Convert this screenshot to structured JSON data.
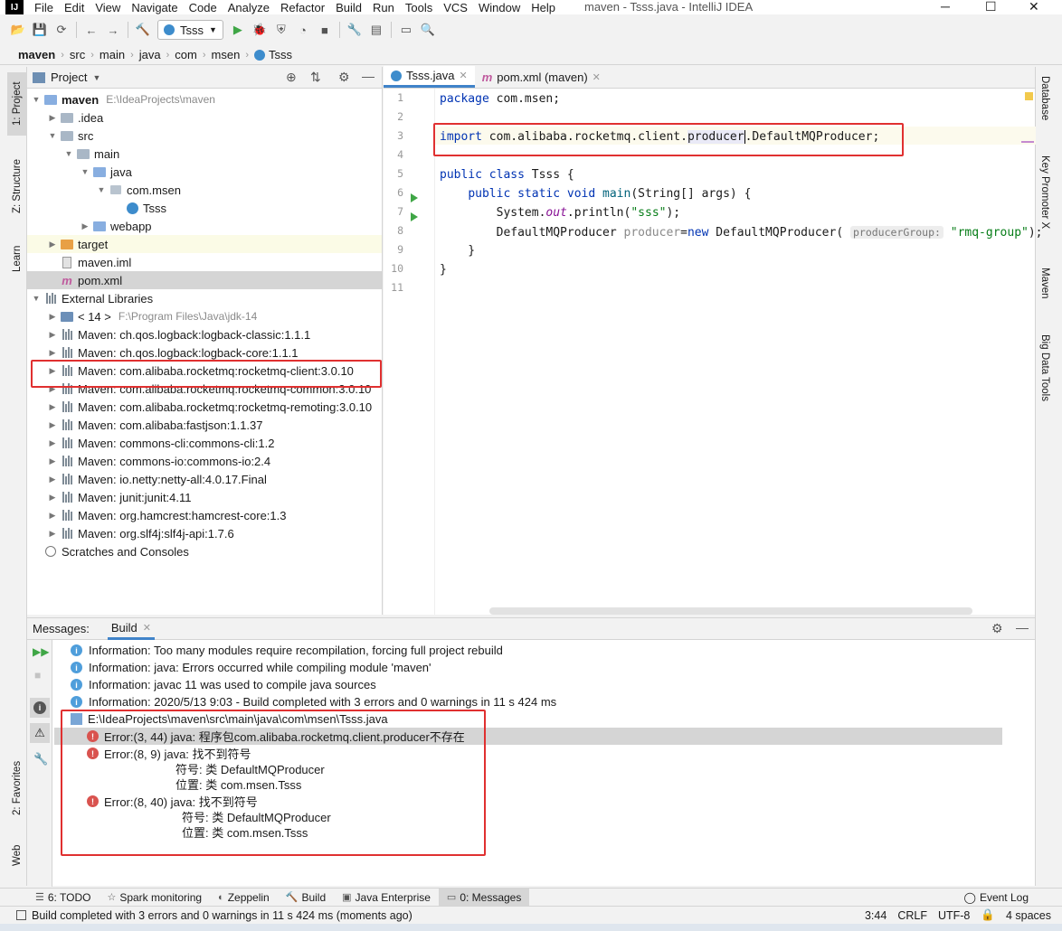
{
  "window": {
    "title": "maven - Tsss.java - IntelliJ IDEA",
    "logo": "IJ"
  },
  "menu": [
    "File",
    "Edit",
    "View",
    "Navigate",
    "Code",
    "Analyze",
    "Refactor",
    "Build",
    "Run",
    "Tools",
    "VCS",
    "Window",
    "Help"
  ],
  "toolbar": {
    "run_config": "Tsss"
  },
  "breadcrumb": [
    "maven",
    "src",
    "main",
    "java",
    "com",
    "msen",
    "Tsss"
  ],
  "left_tabs": {
    "project": "1: Project",
    "structure": "Z: Structure",
    "learn": "Learn",
    "favorites": "2: Favorites",
    "web": "Web"
  },
  "right_tabs": {
    "database": "Database",
    "key_promoter": "Key Promoter X",
    "maven": "Maven",
    "big_data": "Big Data Tools"
  },
  "project": {
    "header": "Project",
    "tree": [
      {
        "label": "maven",
        "extra": "E:\\IdeaProjects\\maven",
        "depth": 0,
        "arrow": "down",
        "icon": "folder-blue",
        "bold": true
      },
      {
        "label": ".idea",
        "depth": 1,
        "arrow": "right",
        "icon": "folder"
      },
      {
        "label": "src",
        "depth": 1,
        "arrow": "down",
        "icon": "folder"
      },
      {
        "label": "main",
        "depth": 2,
        "arrow": "down",
        "icon": "folder"
      },
      {
        "label": "java",
        "depth": 3,
        "arrow": "down",
        "icon": "folder-blue"
      },
      {
        "label": "com.msen",
        "depth": 4,
        "arrow": "down",
        "icon": "package"
      },
      {
        "label": "Tsss",
        "depth": 5,
        "arrow": "",
        "icon": "class"
      },
      {
        "label": "webapp",
        "depth": 3,
        "arrow": "right",
        "icon": "folder-blue"
      },
      {
        "label": "target",
        "depth": 1,
        "arrow": "right",
        "icon": "folder-orange",
        "highlight": "#fbfbe6"
      },
      {
        "label": "maven.iml",
        "depth": 1,
        "arrow": "",
        "icon": "file"
      },
      {
        "label": "pom.xml",
        "depth": 1,
        "arrow": "",
        "icon": "maven",
        "highlight": "#d5d5d5"
      },
      {
        "label": "External Libraries",
        "depth": 0,
        "arrow": "down",
        "icon": "lib"
      },
      {
        "label": "< 14 >",
        "extra": "F:\\Program Files\\Java\\jdk-14",
        "depth": 1,
        "arrow": "right",
        "icon": "jdk"
      },
      {
        "label": "Maven: ch.qos.logback:logback-classic:1.1.1",
        "depth": 1,
        "arrow": "right",
        "icon": "lib"
      },
      {
        "label": "Maven: ch.qos.logback:logback-core:1.1.1",
        "depth": 1,
        "arrow": "right",
        "icon": "lib"
      },
      {
        "label": "Maven: com.alibaba.rocketmq:rocketmq-client:3.0.10",
        "depth": 1,
        "arrow": "right",
        "icon": "lib"
      },
      {
        "label": "Maven: com.alibaba.rocketmq:rocketmq-common:3.0.10",
        "depth": 1,
        "arrow": "right",
        "icon": "lib"
      },
      {
        "label": "Maven: com.alibaba.rocketmq:rocketmq-remoting:3.0.10",
        "depth": 1,
        "arrow": "right",
        "icon": "lib"
      },
      {
        "label": "Maven: com.alibaba:fastjson:1.1.37",
        "depth": 1,
        "arrow": "right",
        "icon": "lib"
      },
      {
        "label": "Maven: commons-cli:commons-cli:1.2",
        "depth": 1,
        "arrow": "right",
        "icon": "lib"
      },
      {
        "label": "Maven: commons-io:commons-io:2.4",
        "depth": 1,
        "arrow": "right",
        "icon": "lib"
      },
      {
        "label": "Maven: io.netty:netty-all:4.0.17.Final",
        "depth": 1,
        "arrow": "right",
        "icon": "lib"
      },
      {
        "label": "Maven: junit:junit:4.11",
        "depth": 1,
        "arrow": "right",
        "icon": "lib"
      },
      {
        "label": "Maven: org.hamcrest:hamcrest-core:1.3",
        "depth": 1,
        "arrow": "right",
        "icon": "lib"
      },
      {
        "label": "Maven: org.slf4j:slf4j-api:1.7.6",
        "depth": 1,
        "arrow": "right",
        "icon": "lib"
      },
      {
        "label": "Scratches and Consoles",
        "depth": 0,
        "arrow": "",
        "icon": "scratch"
      }
    ]
  },
  "editor": {
    "tabs": [
      {
        "label": "Tsss.java",
        "active": true
      },
      {
        "label": "pom.xml (maven)",
        "active": false
      }
    ],
    "line_numbers": [
      "1",
      "2",
      "3",
      "4",
      "5",
      "6",
      "7",
      "8",
      "9",
      "10",
      "11"
    ]
  },
  "messages": {
    "tabs": {
      "messages": "Messages:",
      "build": "Build"
    },
    "info": [
      "Information: Too many modules require recompilation, forcing full project rebuild",
      "Information: java: Errors occurred while compiling module 'maven'",
      "Information: javac 11 was used to compile java sources",
      "Information: 2020/5/13 9:03 - Build completed with 3 errors and 0 warnings in 11 s 424 ms"
    ],
    "file": "E:\\IdeaProjects\\maven\\src\\main\\java\\com\\msen\\Tsss.java",
    "errors": [
      {
        "head": "Error:(3, 44)  java: 程序包com.alibaba.rocketmq.client.producer不存在"
      },
      {
        "head": "Error:(8, 9)  java: 找不到符号",
        "l2": "符号:   类 DefaultMQProducer",
        "l3": "位置: 类 com.msen.Tsss"
      },
      {
        "head": "Error:(8, 40)  java: 找不到符号",
        "l2": "符号:   类 DefaultMQProducer",
        "l3": "位置: 类 com.msen.Tsss"
      }
    ]
  },
  "bottom_tabs": [
    "6: TODO",
    "Spark monitoring",
    "Zeppelin",
    "Build",
    "Java Enterprise",
    "0: Messages"
  ],
  "event_log": "Event Log",
  "status": {
    "message": "Build completed with 3 errors and 0 warnings in 11 s 424 ms (moments ago)",
    "position": "3:44",
    "line_sep": "CRLF",
    "encoding": "UTF-8",
    "indent": "4 spaces"
  }
}
